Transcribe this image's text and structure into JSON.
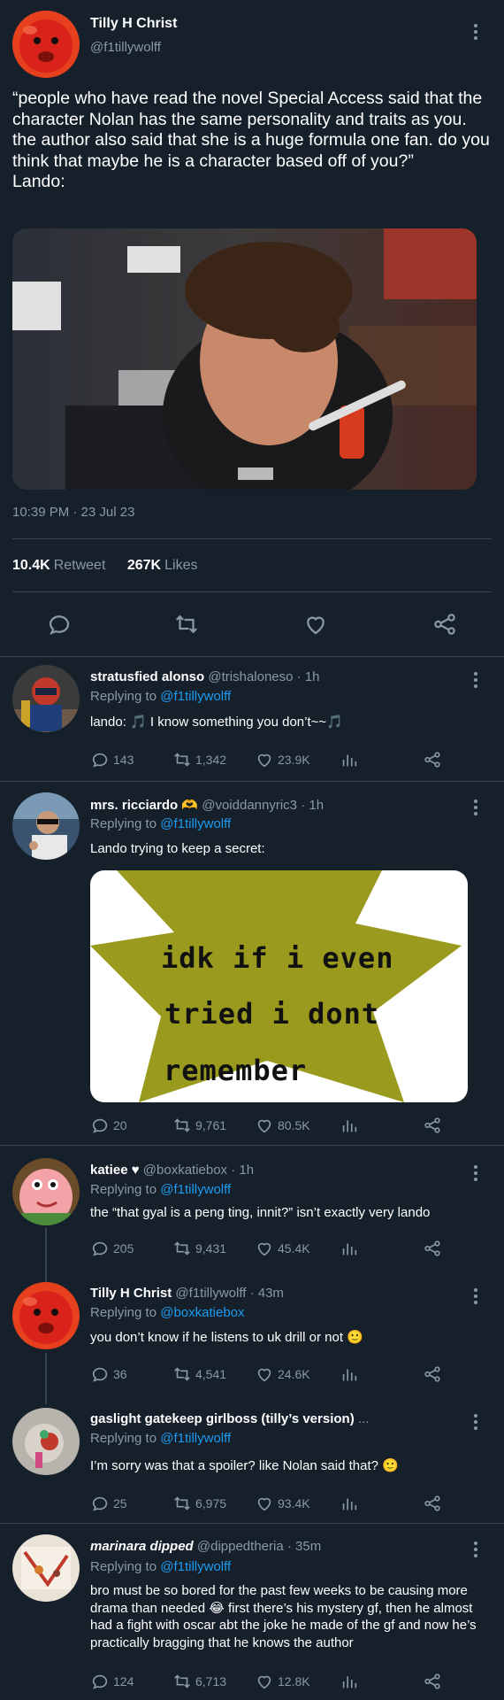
{
  "main": {
    "author_name": "Tilly H Christ",
    "author_handle": "@f1tillywolff",
    "text": "“people who have read the novel Special Access said that the character Nolan has the same personality and traits as you. the author also said that she is a huge formula one fan. do you think that maybe he is a character based off of you?”\nLando:",
    "timestamp": "10:39 PM · 23 Jul 23",
    "retweets_count": "10.4K",
    "retweets_label": "Retweet",
    "likes_count": "267K",
    "likes_label": "Likes"
  },
  "replies": [
    {
      "name": "stratusfied alonso",
      "handle": "@trishaloneso",
      "time": "· 1h",
      "replying_prefix": "Replying to",
      "replying_to": "@f1tillywolff",
      "text": "lando: 🎵 I know something you don’t~~🎵",
      "replies": "143",
      "retweets": "1,342",
      "likes": "23.9K"
    },
    {
      "name": "mrs. ricciardo 🫶",
      "handle": "@voiddannyric3",
      "time": "· 1h",
      "replying_prefix": "Replying to",
      "replying_to": "@f1tillywolff",
      "text": "Lando trying to keep a secret:",
      "meme_lines": [
        "idk if i even",
        "tried i dont",
        "remember"
      ],
      "replies": "20",
      "retweets": "9,761",
      "likes": "80.5K"
    },
    {
      "name": "katiee ♥",
      "handle": "@boxkatiebox",
      "time": "· 1h",
      "replying_prefix": "Replying to",
      "replying_to": "@f1tillywolff",
      "text": "the “that gyal is a peng ting, innit?” isn’t exactly very lando",
      "replies": "205",
      "retweets": "9,431",
      "likes": "45.4K"
    },
    {
      "name": "Tilly H Christ",
      "handle": "@f1tillywolff",
      "time": "· 43m",
      "replying_prefix": "Replying to",
      "replying_to": "@boxkatiebox",
      "text": "you don’t know if he listens to uk drill or not 🙂",
      "replies": "36",
      "retweets": "4,541",
      "likes": "24.6K"
    },
    {
      "name": "gaslight gatekeep girlboss (tilly’s version)",
      "handle": "...",
      "time": "",
      "replying_prefix": "Replying to",
      "replying_to": "@f1tillywolff",
      "text": "I’m sorry was that a spoiler? like Nolan said that? 🙂",
      "replies": "25",
      "retweets": "6,975",
      "likes": "93.4K"
    },
    {
      "name": "marinara dipped",
      "handle": "@dippedtheria",
      "time": "· 35m",
      "replying_prefix": "Replying to",
      "replying_to": "@f1tillywolff",
      "text": "bro must be so bored for the past few weeks to be causing more drama than needed 😂 first there’s his mystery gf, then he almost had a fight with oscar abt the joke he made of the gf and now he’s practically bragging that he knows the author",
      "replies": "124",
      "retweets": "6,713",
      "likes": "12.8K"
    }
  ],
  "icons": {
    "reply": "reply-icon",
    "retweet": "retweet-icon",
    "like": "heart-icon",
    "share": "share-icon",
    "views": "analytics-icon",
    "more": "more-icon"
  },
  "colors": {
    "background": "#15202b",
    "text": "#ffffff",
    "muted": "#8b98a5",
    "link": "#1d9bf0",
    "divider": "#38444d"
  }
}
